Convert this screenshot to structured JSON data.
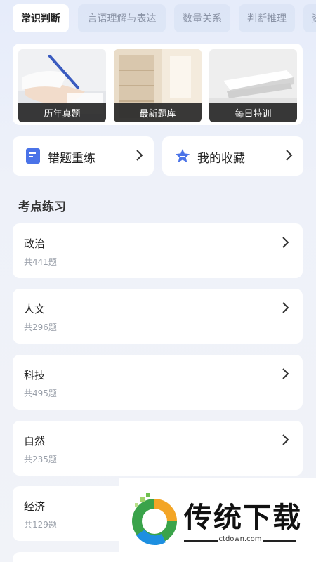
{
  "tabs": [
    {
      "label": "常识判断",
      "active": true
    },
    {
      "label": "言语理解与表达",
      "active": false
    },
    {
      "label": "数量关系",
      "active": false
    },
    {
      "label": "判断推理",
      "active": false
    },
    {
      "label": "资",
      "active": false
    }
  ],
  "banner": {
    "tiles": [
      {
        "caption": "历年真题"
      },
      {
        "caption": "最新题库"
      },
      {
        "caption": "每日特训"
      }
    ]
  },
  "quick": {
    "wrong": {
      "label": "错题重练",
      "icon": "document-icon"
    },
    "favorites": {
      "label": "我的收藏",
      "icon": "star-icon"
    }
  },
  "section": {
    "title": "考点练习"
  },
  "topics": [
    {
      "name": "政治",
      "count": "共441题"
    },
    {
      "name": "人文",
      "count": "共296题"
    },
    {
      "name": "科技",
      "count": "共495题"
    },
    {
      "name": "自然",
      "count": "共235题"
    },
    {
      "name": "经济",
      "count": "共129题"
    }
  ],
  "watermark": {
    "title": "传统下载",
    "subtitle": "ctdown.com"
  },
  "colors": {
    "accent": "#4a73e8",
    "background": "#eef1f9"
  }
}
